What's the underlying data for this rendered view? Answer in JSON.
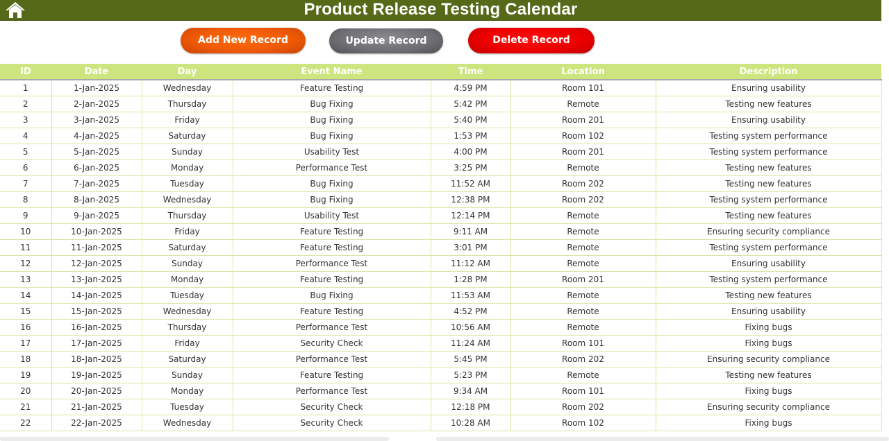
{
  "header": {
    "title": "Product Release Testing Calendar",
    "home_icon": "home-icon"
  },
  "toolbar": {
    "add_label": "Add New Record",
    "update_label": "Update Record",
    "delete_label": "Delete Record"
  },
  "colors": {
    "title_bar": "#556918",
    "header_row": "#cde57e",
    "add_button": "#f05a05",
    "update_button": "#6d6d72",
    "delete_button": "#ee0000",
    "grid_lines": "#d7e8a2"
  },
  "table": {
    "columns": [
      "ID",
      "Date",
      "Day",
      "Event Name",
      "Time",
      "Location",
      "Description"
    ],
    "rows": [
      [
        "1",
        "1-Jan-2025",
        "Wednesday",
        "Feature Testing",
        "4:59 PM",
        "Room 101",
        "Ensuring usability"
      ],
      [
        "2",
        "2-Jan-2025",
        "Thursday",
        "Bug Fixing",
        "5:42 PM",
        "Remote",
        "Testing new features"
      ],
      [
        "3",
        "3-Jan-2025",
        "Friday",
        "Bug Fixing",
        "5:40 PM",
        "Room 201",
        "Ensuring usability"
      ],
      [
        "4",
        "4-Jan-2025",
        "Saturday",
        "Bug Fixing",
        "1:53 PM",
        "Room 102",
        "Testing system performance"
      ],
      [
        "5",
        "5-Jan-2025",
        "Sunday",
        "Usability Test",
        "4:00 PM",
        "Room 201",
        "Testing system performance"
      ],
      [
        "6",
        "6-Jan-2025",
        "Monday",
        "Performance Test",
        "3:25 PM",
        "Remote",
        "Testing new features"
      ],
      [
        "7",
        "7-Jan-2025",
        "Tuesday",
        "Bug Fixing",
        "11:52 AM",
        "Room 202",
        "Testing new features"
      ],
      [
        "8",
        "8-Jan-2025",
        "Wednesday",
        "Bug Fixing",
        "12:38 PM",
        "Room 202",
        "Testing system performance"
      ],
      [
        "9",
        "9-Jan-2025",
        "Thursday",
        "Usability Test",
        "12:14 PM",
        "Remote",
        "Testing new features"
      ],
      [
        "10",
        "10-Jan-2025",
        "Friday",
        "Feature Testing",
        "9:11 AM",
        "Remote",
        "Ensuring security compliance"
      ],
      [
        "11",
        "11-Jan-2025",
        "Saturday",
        "Feature Testing",
        "3:01 PM",
        "Remote",
        "Testing system performance"
      ],
      [
        "12",
        "12-Jan-2025",
        "Sunday",
        "Performance Test",
        "11:12 AM",
        "Remote",
        "Ensuring usability"
      ],
      [
        "13",
        "13-Jan-2025",
        "Monday",
        "Feature Testing",
        "1:28 PM",
        "Room 201",
        "Testing system performance"
      ],
      [
        "14",
        "14-Jan-2025",
        "Tuesday",
        "Bug Fixing",
        "11:53 AM",
        "Remote",
        "Testing new features"
      ],
      [
        "15",
        "15-Jan-2025",
        "Wednesday",
        "Feature Testing",
        "4:52 PM",
        "Remote",
        "Ensuring usability"
      ],
      [
        "16",
        "16-Jan-2025",
        "Thursday",
        "Performance Test",
        "10:56 AM",
        "Remote",
        "Fixing bugs"
      ],
      [
        "17",
        "17-Jan-2025",
        "Friday",
        "Security Check",
        "11:24 AM",
        "Room 101",
        "Fixing bugs"
      ],
      [
        "18",
        "18-Jan-2025",
        "Saturday",
        "Performance Test",
        "5:45 PM",
        "Room 202",
        "Ensuring security compliance"
      ],
      [
        "19",
        "19-Jan-2025",
        "Sunday",
        "Feature Testing",
        "5:23 PM",
        "Remote",
        "Testing new features"
      ],
      [
        "20",
        "20-Jan-2025",
        "Monday",
        "Performance Test",
        "9:34 AM",
        "Room 101",
        "Fixing bugs"
      ],
      [
        "21",
        "21-Jan-2025",
        "Tuesday",
        "Security Check",
        "12:18 PM",
        "Room 202",
        "Ensuring security compliance"
      ],
      [
        "22",
        "22-Jan-2025",
        "Wednesday",
        "Security Check",
        "10:28 AM",
        "Room 102",
        "Fixing bugs"
      ]
    ]
  }
}
